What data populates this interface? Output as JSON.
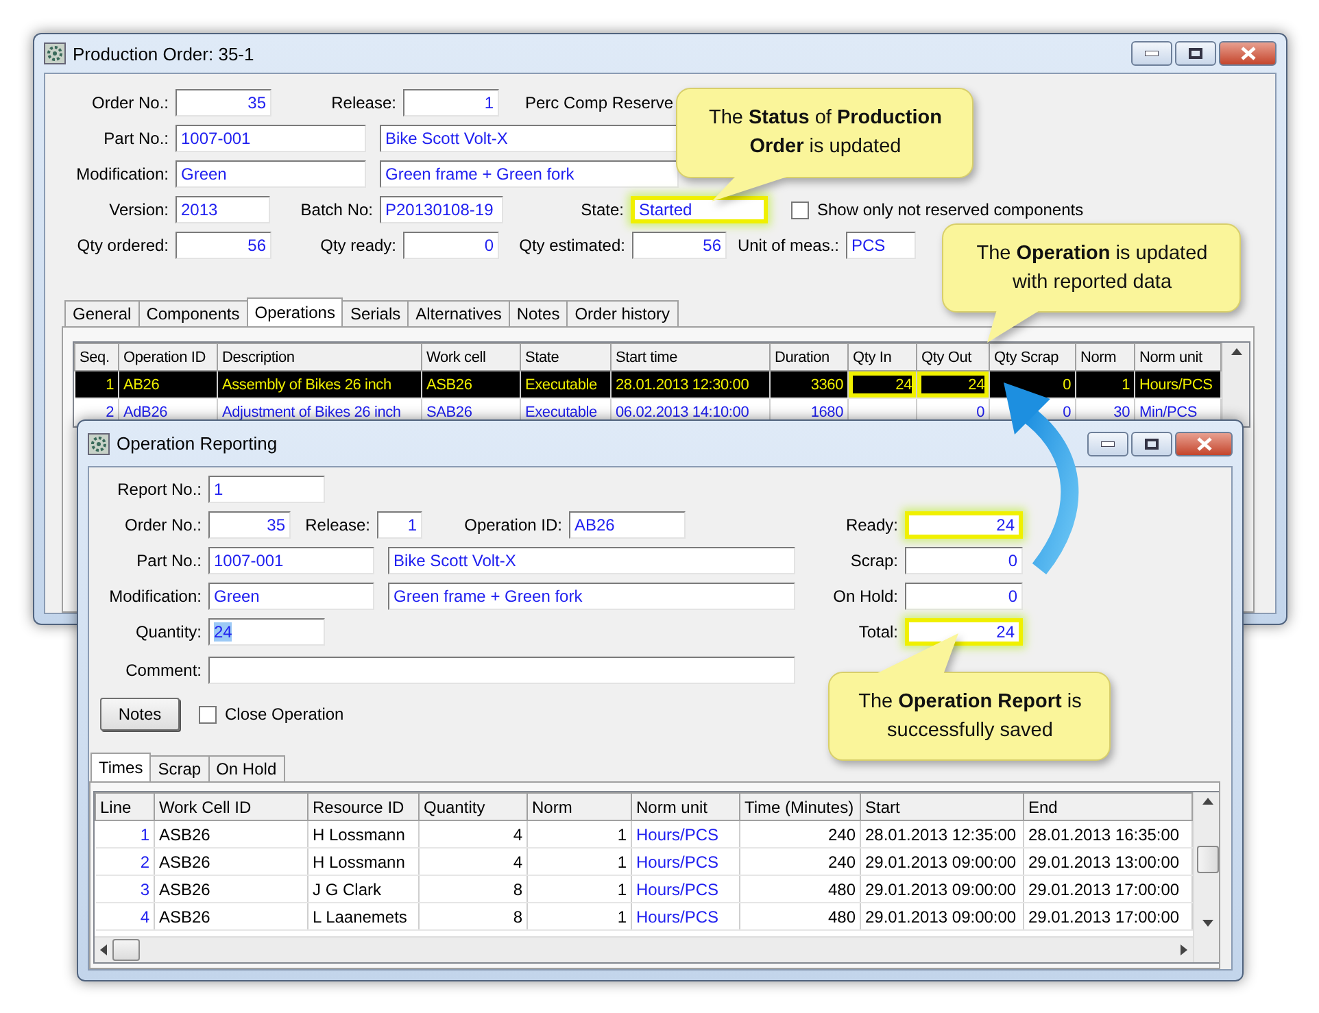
{
  "production_order": {
    "title": "Production Order: 35-1",
    "order_no": {
      "label": "Order No.:",
      "value": "35"
    },
    "release": {
      "label": "Release:",
      "value": "1"
    },
    "perc_comp_label": "Perc Comp Reserve",
    "part_no": {
      "label": "Part No.:",
      "value": "1007-001",
      "description": "Bike Scott Volt-X"
    },
    "modification": {
      "label": "Modification:",
      "value": "Green",
      "description": "Green frame + Green fork"
    },
    "version": {
      "label": "Version:",
      "value": "2013"
    },
    "batch_no": {
      "label": "Batch No:",
      "value": "P20130108-19"
    },
    "state": {
      "label": "State:",
      "value": "Started",
      "highlighted": true
    },
    "show_only_not_reserved": {
      "label": "Show only not reserved components",
      "checked": false
    },
    "qty_ordered": {
      "label": "Qty ordered:",
      "value": "56"
    },
    "qty_ready": {
      "label": "Qty ready:",
      "value": "0"
    },
    "qty_estimated": {
      "label": "Qty estimated:",
      "value": "56"
    },
    "unit": {
      "label": "Unit of meas.:",
      "value": "PCS"
    },
    "tabs": [
      {
        "label": "General",
        "selected": false
      },
      {
        "label": "Components",
        "selected": false
      },
      {
        "label": "Operations",
        "selected": true
      },
      {
        "label": "Serials",
        "selected": false
      },
      {
        "label": "Alternatives",
        "selected": false
      },
      {
        "label": "Notes",
        "selected": false
      },
      {
        "label": "Order history",
        "selected": false
      }
    ],
    "table": {
      "columns": [
        "Seq.",
        "Operation ID",
        "Description",
        "Work cell",
        "State",
        "Start time",
        "Duration",
        "Qty In",
        "Qty Out",
        "Qty Scrap",
        "Norm",
        "Norm unit"
      ],
      "rows": [
        {
          "selected": true,
          "cells": [
            "1",
            "AB26",
            "Assembly of Bikes 26 inch",
            "ASB26",
            "Executable",
            "28.01.2013 12:30:00",
            "3360",
            {
              "text": "24",
              "highlighted": true
            },
            {
              "text": "24",
              "highlighted": true
            },
            "0",
            "1",
            "Hours/PCS"
          ]
        },
        {
          "selected": false,
          "cells": [
            "2",
            "AdB26",
            "Adjustment of Bikes 26 inch",
            "SAB26",
            "Executable",
            "06.02.2013 14:10:00",
            "1680",
            null,
            "0",
            "0",
            "30",
            "Min/PCS"
          ]
        }
      ]
    }
  },
  "operation_reporting": {
    "title": "Operation Reporting",
    "report_no": {
      "label": "Report No.:",
      "value": "1"
    },
    "order_no": {
      "label": "Order No.:",
      "value": "35"
    },
    "release": {
      "label": "Release:",
      "value": "1"
    },
    "operation_id": {
      "label": "Operation ID:",
      "value": "AB26"
    },
    "part_no": {
      "label": "Part No.:",
      "value": "1007-001",
      "description": "Bike Scott Volt-X"
    },
    "modification": {
      "label": "Modification:",
      "value": "Green",
      "description": "Green frame + Green fork"
    },
    "quantity": {
      "label": "Quantity:",
      "value": "24",
      "text_selected": true
    },
    "comment": {
      "label": "Comment:"
    },
    "totals": [
      {
        "label": "Ready:",
        "value": "24",
        "highlighted": true
      },
      {
        "label": "Scrap:",
        "value": "0",
        "highlighted": false
      },
      {
        "label": "On Hold:",
        "value": "0",
        "highlighted": false
      },
      {
        "label": "Total:",
        "value": "24",
        "highlighted": true
      }
    ],
    "notes_button": "Notes",
    "close_operation": {
      "label": "Close Operation",
      "checked": false
    },
    "tabs": [
      {
        "label": "Times",
        "selected": true
      },
      {
        "label": "Scrap",
        "selected": false
      },
      {
        "label": "On Hold",
        "selected": false
      }
    ],
    "table": {
      "columns": [
        "Line",
        "Work Cell ID",
        "Resource ID",
        "Quantity",
        "Norm",
        "Norm unit",
        "Time (Minutes)",
        "Start",
        "End"
      ],
      "rows": [
        [
          "1",
          "ASB26",
          "H Lossmann",
          "4",
          "1",
          "Hours/PCS",
          "240",
          "28.01.2013 12:35:00",
          "28.01.2013 16:35:00"
        ],
        [
          "2",
          "ASB26",
          "H Lossmann",
          "4",
          "1",
          "Hours/PCS",
          "240",
          "29.01.2013 09:00:00",
          "29.01.2013 13:00:00"
        ],
        [
          "3",
          "ASB26",
          "J G Clark",
          "8",
          "1",
          "Hours/PCS",
          "480",
          "29.01.2013 09:00:00",
          "29.01.2013 17:00:00"
        ],
        [
          "4",
          "ASB26",
          "L Laanemets",
          "8",
          "1",
          "Hours/PCS",
          "480",
          "29.01.2013 09:00:00",
          "29.01.2013 17:00:00"
        ]
      ]
    }
  },
  "callouts": [
    {
      "text": "The **Status** of **Production Order** is updated"
    },
    {
      "text": "The **Operation** is updated with reported data"
    },
    {
      "text": "The **Operation Report** is successfully saved"
    }
  ]
}
